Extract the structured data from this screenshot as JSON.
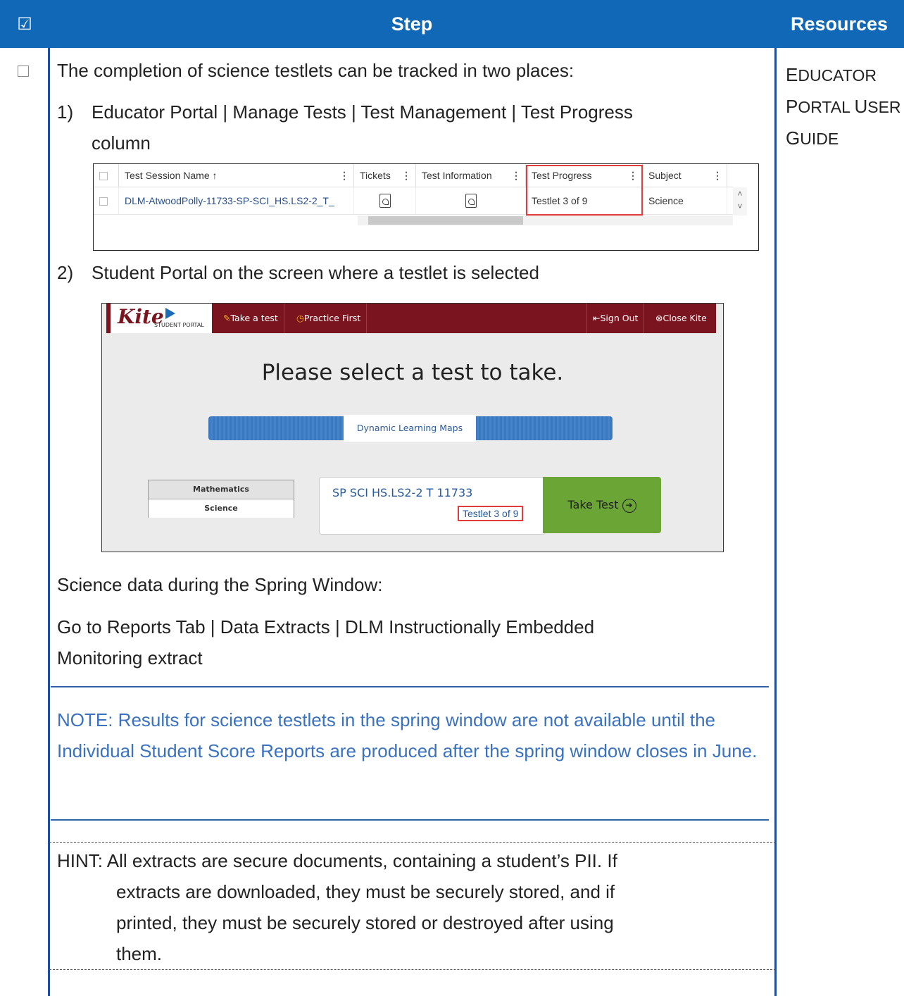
{
  "header": {
    "check_glyph": "☑",
    "step": "Step",
    "resources": "Resources"
  },
  "resources": {
    "line1_big": "E",
    "line1_small": "DUCATOR",
    "line2a_big": "P",
    "line2a_small": "ORTAL ",
    "line2b_big": "U",
    "line2b_small": "SER",
    "line3_big": "G",
    "line3_small": "UIDE"
  },
  "step": {
    "intro": "The completion of science testlets can be tracked in two places:",
    "item1_num": "1)",
    "item1_line1": "Educator Portal | Manage Tests | Test Management | Test Progress",
    "item1_line2": "column",
    "item2_num": "2)",
    "item2_text": "Student Portal on the screen where a testlet is selected",
    "science_data": "Science data during the Spring Window:",
    "goto_line1": "Go to Reports Tab | Data Extracts | DLM Instructionally Embedded",
    "goto_line2": "Monitoring extract",
    "note": "NOTE: Results for science testlets in the spring window are not available until the Individual Student Score Reports are produced after the spring window closes in June.",
    "hint_line1": "HINT: All extracts are secure documents, containing a student’s PII. If",
    "hint_line2": "extracts are downloaded, they must be securely stored, and if",
    "hint_line3": "printed, they must be securely stored or destroyed after using",
    "hint_line4": "them."
  },
  "educator_table": {
    "headers": [
      "Test Session Name ↑",
      "Tickets",
      "Test Information",
      "Test Progress",
      "Subject"
    ],
    "row": {
      "session": "DLM-AtwoodPolly-11733-SP-SCI_HS.LS2-2_T_",
      "progress": "Testlet 3 of 9",
      "subject": "Science"
    }
  },
  "student_portal": {
    "logo": "Kite",
    "logo_sub": "STUDENT PORTAL",
    "nav_take": "Take a test",
    "nav_practice": "Practice First",
    "nav_signout": "Sign Out",
    "nav_close": "Close Kite",
    "title": "Please select a test to take.",
    "tab": "Dynamic Learning Maps",
    "subjects": [
      "Mathematics",
      "Science"
    ],
    "test_name": "SP SCI HS.LS2-2 T 11733",
    "testlet": "Testlet 3 of 9",
    "take_test": "Take Test"
  }
}
